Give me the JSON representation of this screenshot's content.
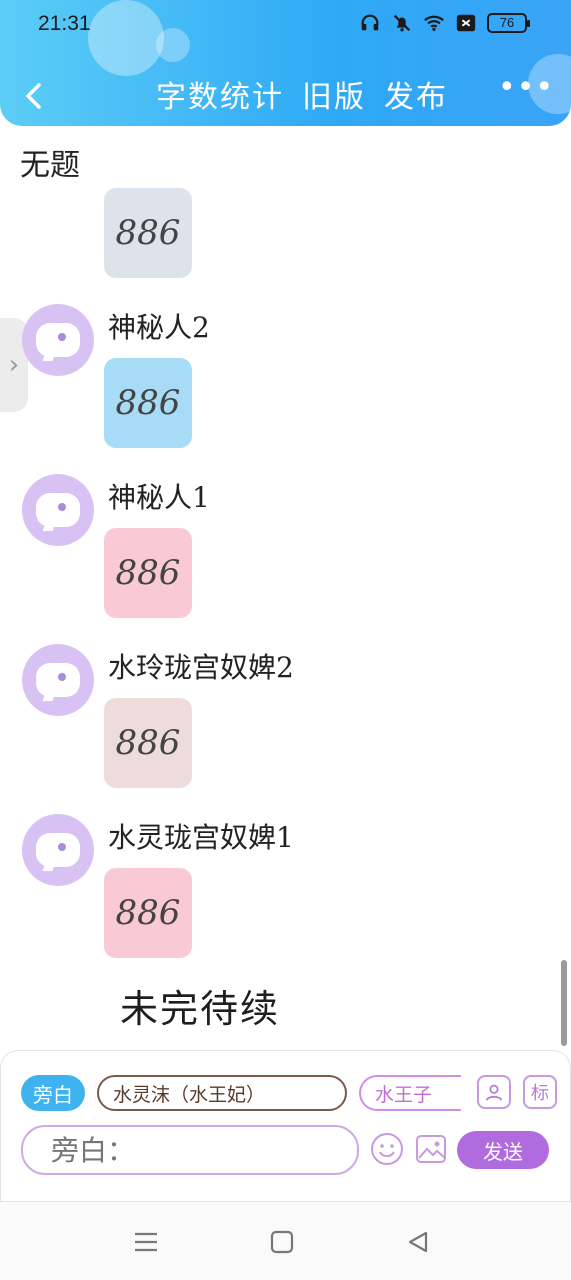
{
  "status_bar": {
    "time": "21:31",
    "battery": "76",
    "icons": [
      "headphones-icon",
      "mute-bell-icon",
      "wifi-icon",
      "sim-off-icon",
      "battery-icon"
    ]
  },
  "header": {
    "title_parts": [
      "字数统计",
      "旧版",
      "发布"
    ],
    "more_label": "•••",
    "back_icon": "chevron-left-icon",
    "gradient": [
      "#5ccdf7",
      "#2ea8f5"
    ]
  },
  "subheading": "无题",
  "side_tab": {
    "label": "›"
  },
  "messages": [
    {
      "name": "",
      "text": "886",
      "bubble_color": "#dde3ea"
    },
    {
      "name": "神秘人2",
      "text": "886",
      "bubble_color": "#a8dcf6"
    },
    {
      "name": "神秘人1",
      "text": "886",
      "bubble_color": "#fac9d6"
    },
    {
      "name": "水玲珑宫奴婢2",
      "text": "886",
      "bubble_color": "#eedcdc"
    },
    {
      "name": "水灵珑宫奴婢1",
      "text": "886",
      "bubble_color": "#fac9d6"
    }
  ],
  "pending_text": "未完待续",
  "composer": {
    "side_label": "旁白",
    "role_chips": [
      "水灵沫（水王妃）",
      "水王子"
    ],
    "contact_icon": "person-icon",
    "mark_label": "标",
    "input_placeholder": "旁白：",
    "emoji_icon": "smiley-icon",
    "image_icon": "image-icon",
    "send_label": "发送",
    "accent": "#b06cdf"
  },
  "nav_bar": {
    "icons": [
      "menu-icon",
      "home-square-icon",
      "back-triangle-icon"
    ]
  }
}
